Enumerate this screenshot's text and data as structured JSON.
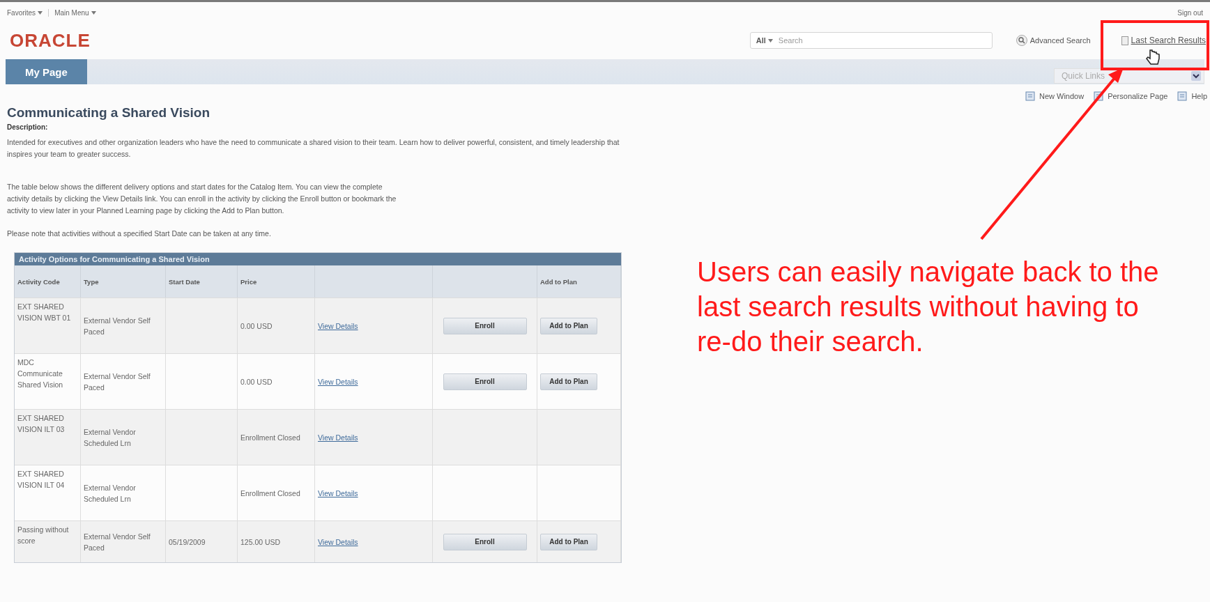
{
  "top_menu": {
    "items": [
      "Favorites",
      "Main Menu"
    ],
    "sign_out": "Sign out"
  },
  "header": {
    "logo": "ORACLE",
    "search": {
      "scope": "All",
      "placeholder": "Search"
    },
    "advanced_search": "Advanced Search",
    "last_search_results": "Last Search Results"
  },
  "nav": {
    "tabs": [
      {
        "label": "My Page",
        "selected": true
      }
    ],
    "quick_links": {
      "placeholder": "Quick Links"
    }
  },
  "page_actions": [
    "New Window",
    "Personalize Page",
    "Help"
  ],
  "content": {
    "title": "Communicating a Shared Vision",
    "description_label": "Description:",
    "description": "Intended for executives and other organization leaders who have the need to communicate a shared vision to their team. Learn how to deliver powerful, consistent, and timely leadership that inspires your team to greater success.",
    "paragraphs": [
      "The table below shows the different delivery options and start dates for the Catalog Item. You can view the complete activity details by clicking the View Details link. You can enroll in the activity by clicking the Enroll button or bookmark the activity to view later in your Planned Learning page by clicking the Add to Plan button.",
      "Please note that activities without a specified Start Date can be taken at any time."
    ]
  },
  "table": {
    "title": "Activity Options for Communicating a Shared Vision",
    "columns": [
      "Activity Code",
      "Type",
      "Start Date",
      "Price"
    ],
    "add_to_plan_heading": "Add to Plan",
    "rows": [
      {
        "code": "EXT SHARED VISION WBT 01",
        "type": "External Vendor Self Paced",
        "price": "0.00 USD",
        "link": "View Details",
        "enroll": "Enroll",
        "add": "Add to Plan"
      },
      {
        "code": "MDC Communicate Shared Vision",
        "type": "External Vendor Self Paced",
        "price": "0.00 USD",
        "link": "View Details",
        "enroll": "Enroll",
        "add": "Add to Plan"
      },
      {
        "code": "EXT SHARED VISION ILT 03",
        "type": "External Vendor Scheduled Lrn",
        "price": "Enrollment Closed",
        "link": "View Details"
      },
      {
        "code": "EXT SHARED VISION ILT 04",
        "type": "External Vendor Scheduled Lrn",
        "price": "Enrollment Closed",
        "link": "View Details"
      },
      {
        "code": "Passing without score",
        "type": "External Vendor Self Paced",
        "start": "05/19/2009",
        "price": "125.00 USD",
        "link": "View Details",
        "enroll": "Enroll",
        "add": "Add to Plan"
      }
    ]
  },
  "annotation": "Users can easily navigate back to the last search results without having to re-do their search."
}
